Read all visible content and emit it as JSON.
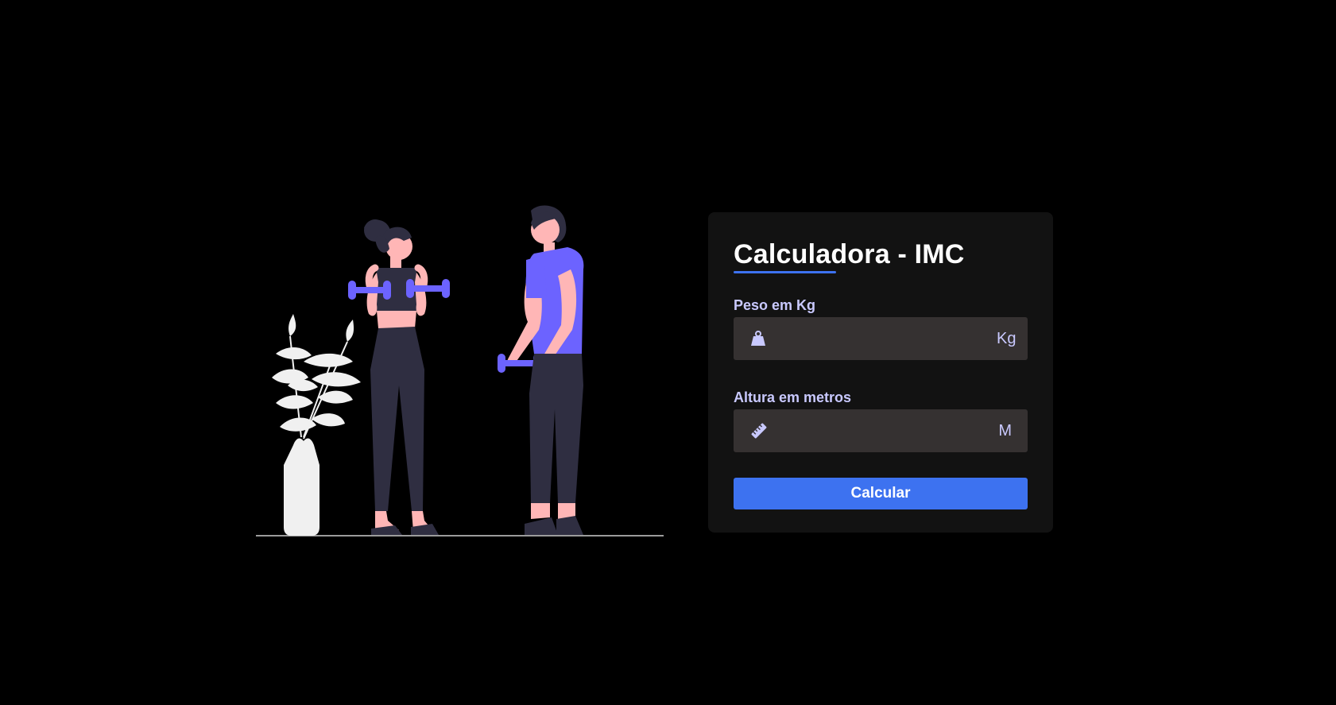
{
  "colors": {
    "background": "#000000",
    "card": "#121212",
    "field": "#353131",
    "accent_blue": "#3d72f0",
    "label": "#c9c9ff",
    "illustration_purple": "#6c63ff",
    "skin": "#ffb6b6",
    "dark_clothing": "#2f2e41",
    "plant": "#f0f0f0"
  },
  "card": {
    "title": "Calculadora - IMC"
  },
  "weight": {
    "label": "Peso em Kg",
    "icon": "weight-icon",
    "placeholder": "",
    "unit": "Kg"
  },
  "height": {
    "label": "Altura em metros",
    "icon": "ruler-icon",
    "placeholder": "",
    "unit": "M"
  },
  "actions": {
    "calculate_label": "Calcular"
  }
}
